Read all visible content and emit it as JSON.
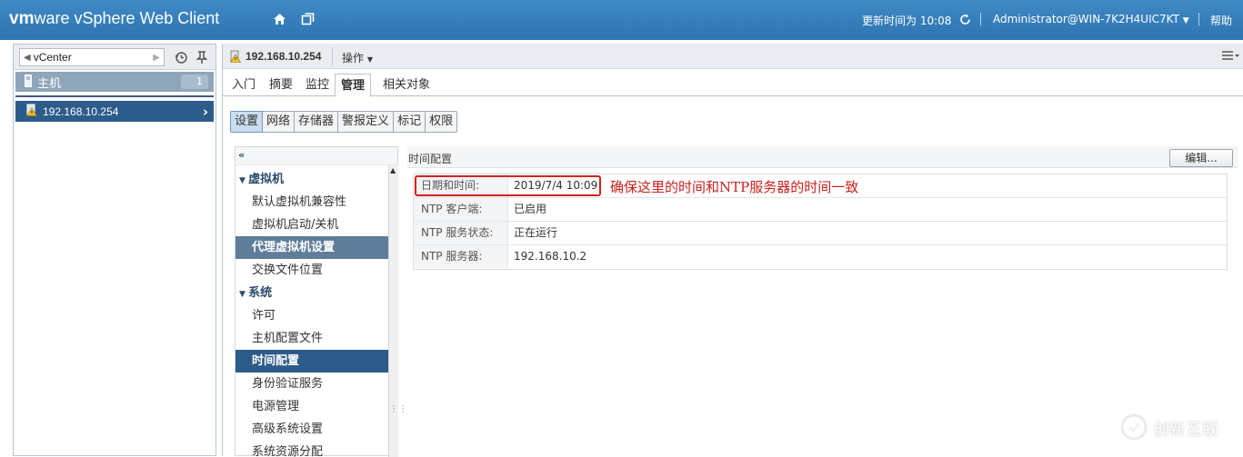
{
  "header": {
    "brand_vm": "vm",
    "brand_ware": "ware",
    "brand_product": "vSphere Web Client",
    "update_time": "更新时间为 10:08",
    "user": "Administrator@WIN-7K2H4UIC7KT",
    "help": "帮助"
  },
  "navigator": {
    "root": "vCenter",
    "group_label": "主机",
    "group_count": "1",
    "selected_host": "192.168.10.254"
  },
  "object": {
    "title": "192.168.10.254",
    "actions_label": "操作"
  },
  "tabs": [
    "入门",
    "摘要",
    "监控",
    "管理",
    "相关对象"
  ],
  "active_tab": "管理",
  "subtabs": [
    "设置",
    "网络",
    "存储器",
    "警报定义",
    "标记",
    "权限"
  ],
  "active_subtab": "设置",
  "settings_list": [
    {
      "label": "虚拟机",
      "kind": "group"
    },
    {
      "label": "默认虚拟机兼容性",
      "kind": "item"
    },
    {
      "label": "虚拟机启动/关机",
      "kind": "item"
    },
    {
      "label": "代理虚拟机设置",
      "kind": "hover"
    },
    {
      "label": "交换文件位置",
      "kind": "item"
    },
    {
      "label": "系统",
      "kind": "group"
    },
    {
      "label": "许可",
      "kind": "item"
    },
    {
      "label": "主机配置文件",
      "kind": "item"
    },
    {
      "label": "时间配置",
      "kind": "selected"
    },
    {
      "label": "身份验证服务",
      "kind": "item"
    },
    {
      "label": "电源管理",
      "kind": "item"
    },
    {
      "label": "高级系统设置",
      "kind": "item"
    },
    {
      "label": "系统资源分配",
      "kind": "item"
    }
  ],
  "time_config": {
    "section_title": "时间配置",
    "edit_label": "编辑...",
    "rows": [
      {
        "key": "日期和时间:",
        "value": "2019/7/4 10:09"
      },
      {
        "key": "NTP 客户端:",
        "value": "已启用"
      },
      {
        "key": "NTP 服务状态:",
        "value": "正在运行"
      },
      {
        "key": "NTP 服务器:",
        "value": "192.168.10.2"
      }
    ],
    "annotation": "确保这里的时间和NTP服务器的时间一致"
  },
  "watermark": "创新互联",
  "colors": {
    "header_blue": "#3577b5",
    "selection_blue": "#2d5b8a",
    "annotation_red": "#c9211d"
  }
}
